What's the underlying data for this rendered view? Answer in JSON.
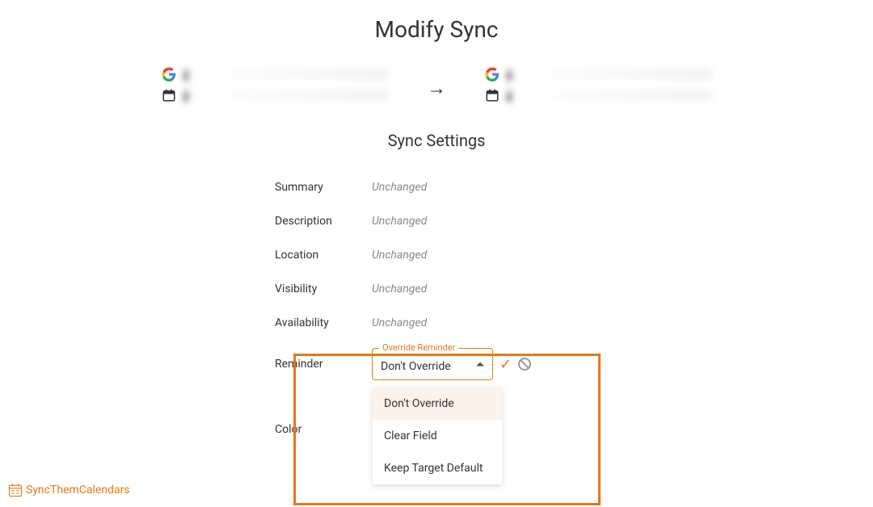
{
  "title": "Modify Sync",
  "source": {
    "account_start": "c",
    "calendar_start": "c"
  },
  "target": {
    "account_start": "c",
    "calendar_start": "c"
  },
  "section_title": "Sync Settings",
  "settings": {
    "summary": {
      "label": "Summary",
      "value": "Unchanged"
    },
    "description": {
      "label": "Description",
      "value": "Unchanged"
    },
    "location": {
      "label": "Location",
      "value": "Unchanged"
    },
    "visibility": {
      "label": "Visibility",
      "value": "Unchanged"
    },
    "availability": {
      "label": "Availability",
      "value": "Unchanged"
    },
    "reminder": {
      "label": "Reminder"
    },
    "color": {
      "label": "Color"
    }
  },
  "reminder_select": {
    "legend": "Override Reminder",
    "value": "Don't Override",
    "options": [
      "Don't Override",
      "Clear Field",
      "Keep Target Default"
    ]
  },
  "brand": "SyncThemCalendars"
}
